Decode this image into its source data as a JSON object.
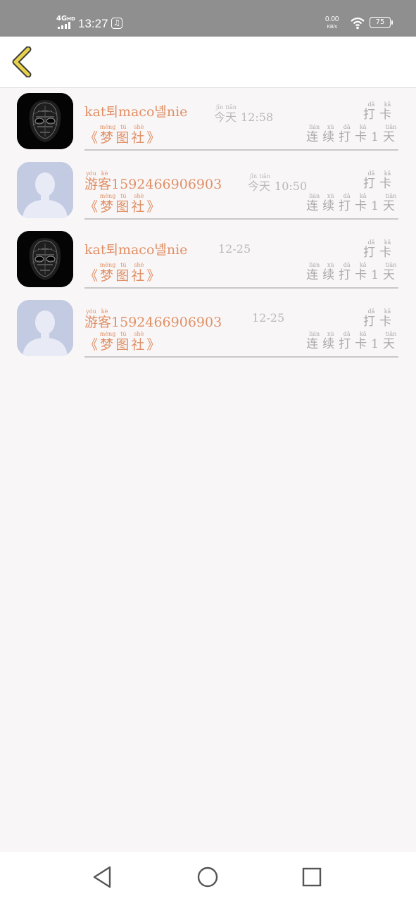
{
  "status_bar": {
    "network": "4G",
    "network_sub": "HD",
    "time": "13:27",
    "speed_value": "0.00",
    "speed_unit": "KB/s",
    "battery": "75"
  },
  "colors": {
    "accent": "#e19066",
    "muted": "#aaaaaa",
    "back_icon": "#e8d24d"
  },
  "list": {
    "items": [
      {
        "avatar": "mask-avatar",
        "name": "kat퇴maco녤nie",
        "name_parts": [
          {
            "text": "kat퇴maco녤nie"
          }
        ],
        "time_word": [
          {
            "text": "今",
            "py": "jīn"
          },
          {
            "text": "天",
            "py": "tiān"
          }
        ],
        "time_value": "12:58",
        "action": [
          {
            "text": "打",
            "py": "dǎ"
          },
          {
            "text": "卡",
            "py": "kǎ"
          }
        ],
        "book_open": "《",
        "book": [
          {
            "text": "梦",
            "py": "mèng"
          },
          {
            "text": "图",
            "py": "tú"
          },
          {
            "text": "社",
            "py": "shè"
          }
        ],
        "book_close": "》",
        "streak_a": [
          {
            "text": "连",
            "py": "lián"
          },
          {
            "text": "续",
            "py": "xù"
          },
          {
            "text": "打",
            "py": "dǎ"
          },
          {
            "text": "卡",
            "py": "kǎ"
          }
        ],
        "streak_num": "1",
        "streak_b": [
          {
            "text": "天",
            "py": "tiān"
          }
        ]
      },
      {
        "avatar": "guest-avatar",
        "name_prefix": [
          {
            "text": "游",
            "py": "yóu"
          },
          {
            "text": "客",
            "py": "kè"
          }
        ],
        "name": "1592466906903",
        "time_word": [
          {
            "text": "今",
            "py": "jīn"
          },
          {
            "text": "天",
            "py": "tiān"
          }
        ],
        "time_value": "10:50",
        "action": [
          {
            "text": "打",
            "py": "dǎ"
          },
          {
            "text": "卡",
            "py": "kǎ"
          }
        ],
        "book_open": "《",
        "book": [
          {
            "text": "梦",
            "py": "mèng"
          },
          {
            "text": "图",
            "py": "tú"
          },
          {
            "text": "社",
            "py": "shè"
          }
        ],
        "book_close": "》",
        "streak_a": [
          {
            "text": "连",
            "py": "lián"
          },
          {
            "text": "续",
            "py": "xù"
          },
          {
            "text": "打",
            "py": "dǎ"
          },
          {
            "text": "卡",
            "py": "kǎ"
          }
        ],
        "streak_num": "1",
        "streak_b": [
          {
            "text": "天",
            "py": "tiān"
          }
        ]
      },
      {
        "avatar": "mask-avatar",
        "name": "kat퇴maco녤nie",
        "time_value": "12-25",
        "action": [
          {
            "text": "打",
            "py": "dǎ"
          },
          {
            "text": "卡",
            "py": "kǎ"
          }
        ],
        "book_open": "《",
        "book": [
          {
            "text": "梦",
            "py": "mèng"
          },
          {
            "text": "图",
            "py": "tú"
          },
          {
            "text": "社",
            "py": "shè"
          }
        ],
        "book_close": "》",
        "streak_a": [
          {
            "text": "连",
            "py": "lián"
          },
          {
            "text": "续",
            "py": "xù"
          },
          {
            "text": "打",
            "py": "dǎ"
          },
          {
            "text": "卡",
            "py": "kǎ"
          }
        ],
        "streak_num": "1",
        "streak_b": [
          {
            "text": "天",
            "py": "tiān"
          }
        ]
      },
      {
        "avatar": "guest-avatar",
        "name_prefix": [
          {
            "text": "游",
            "py": "yóu"
          },
          {
            "text": "客",
            "py": "kè"
          }
        ],
        "name": "1592466906903",
        "time_value": "12-25",
        "action": [
          {
            "text": "打",
            "py": "dǎ"
          },
          {
            "text": "卡",
            "py": "kǎ"
          }
        ],
        "book_open": "《",
        "book": [
          {
            "text": "梦",
            "py": "mèng"
          },
          {
            "text": "图",
            "py": "tú"
          },
          {
            "text": "社",
            "py": "shè"
          }
        ],
        "book_close": "》",
        "streak_a": [
          {
            "text": "连",
            "py": "lián"
          },
          {
            "text": "续",
            "py": "xù"
          },
          {
            "text": "打",
            "py": "dǎ"
          },
          {
            "text": "卡",
            "py": "kǎ"
          }
        ],
        "streak_num": "1",
        "streak_b": [
          {
            "text": "天",
            "py": "tiān"
          }
        ]
      }
    ]
  }
}
